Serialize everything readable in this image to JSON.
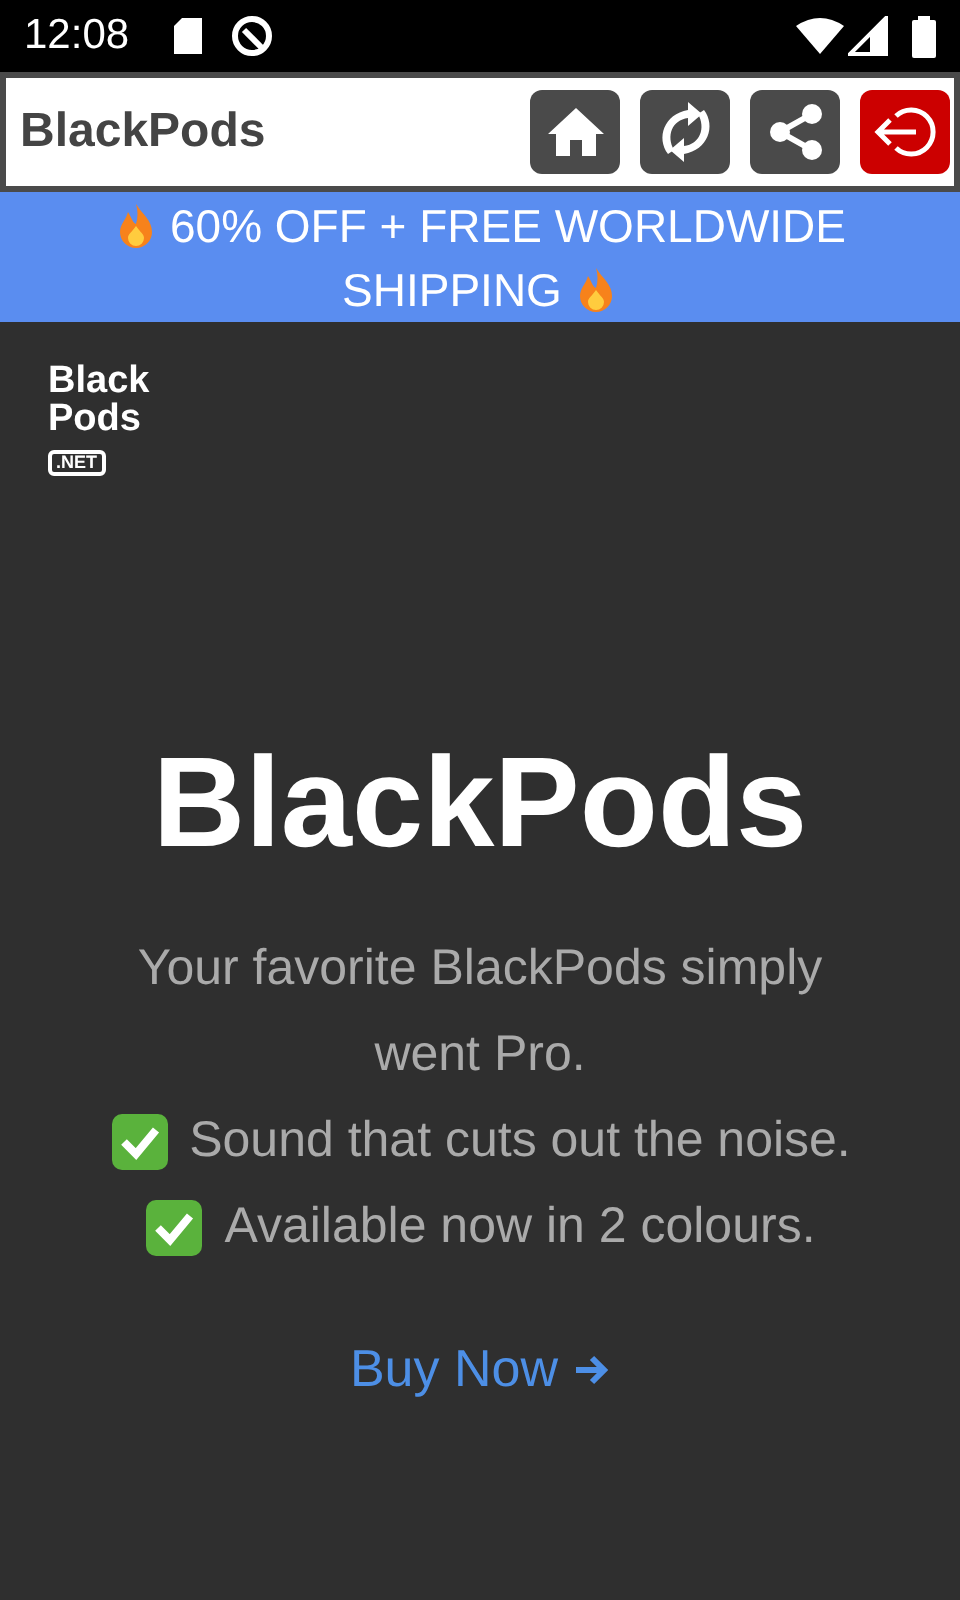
{
  "status_bar": {
    "time": "12:08"
  },
  "app_bar": {
    "title": "BlackPods",
    "buttons": [
      {
        "kind": "home"
      },
      {
        "kind": "refresh"
      },
      {
        "kind": "share"
      },
      {
        "kind": "exit"
      }
    ]
  },
  "promo_banner": {
    "lines": [
      "60% OFF + FREE WORLDWIDE",
      "SHIPPING"
    ]
  },
  "logo": {
    "lines": [
      "Black",
      "Pods"
    ],
    "badge": ".NET"
  },
  "hero": {
    "title": "BlackPods",
    "subtitle": "Your favorite BlackPods simply went Pro.",
    "features": [
      "Sound that cuts out the noise.",
      "Available now in 2 colours."
    ],
    "cta": "Buy Now"
  }
}
